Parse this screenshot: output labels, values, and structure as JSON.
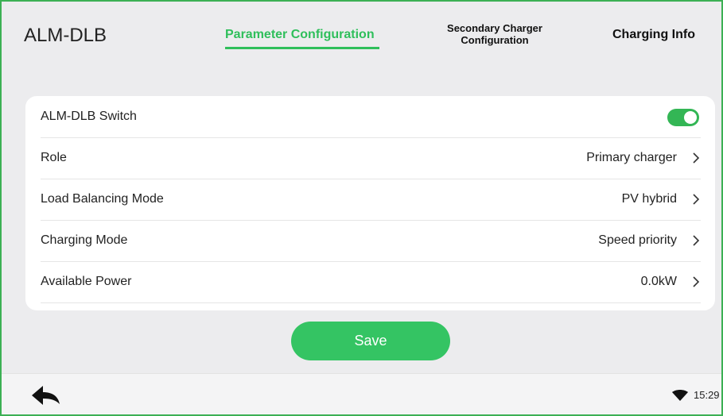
{
  "header": {
    "app_title": "ALM-DLB",
    "tabs": {
      "parameter_configuration": "Parameter Configuration",
      "secondary_charger_configuration": "Secondary Charger Configuration",
      "charging_info": "Charging Info"
    },
    "active_tab": "Parameter Configuration",
    "accent_color": "#2fbf5b"
  },
  "settings": {
    "switch": {
      "label": "ALM-DLB Switch",
      "enabled": true
    },
    "rows": [
      {
        "label": "Role",
        "value": "Primary charger"
      },
      {
        "label": "Load Balancing Mode",
        "value": "PV hybrid"
      },
      {
        "label": "Charging Mode",
        "value": "Speed priority"
      },
      {
        "label": "Available Power",
        "value": "0.0kW"
      }
    ]
  },
  "save_label": "Save",
  "status_bar": {
    "time": "15:29",
    "icons": [
      "back-arrow-icon",
      "wifi-icon"
    ]
  }
}
